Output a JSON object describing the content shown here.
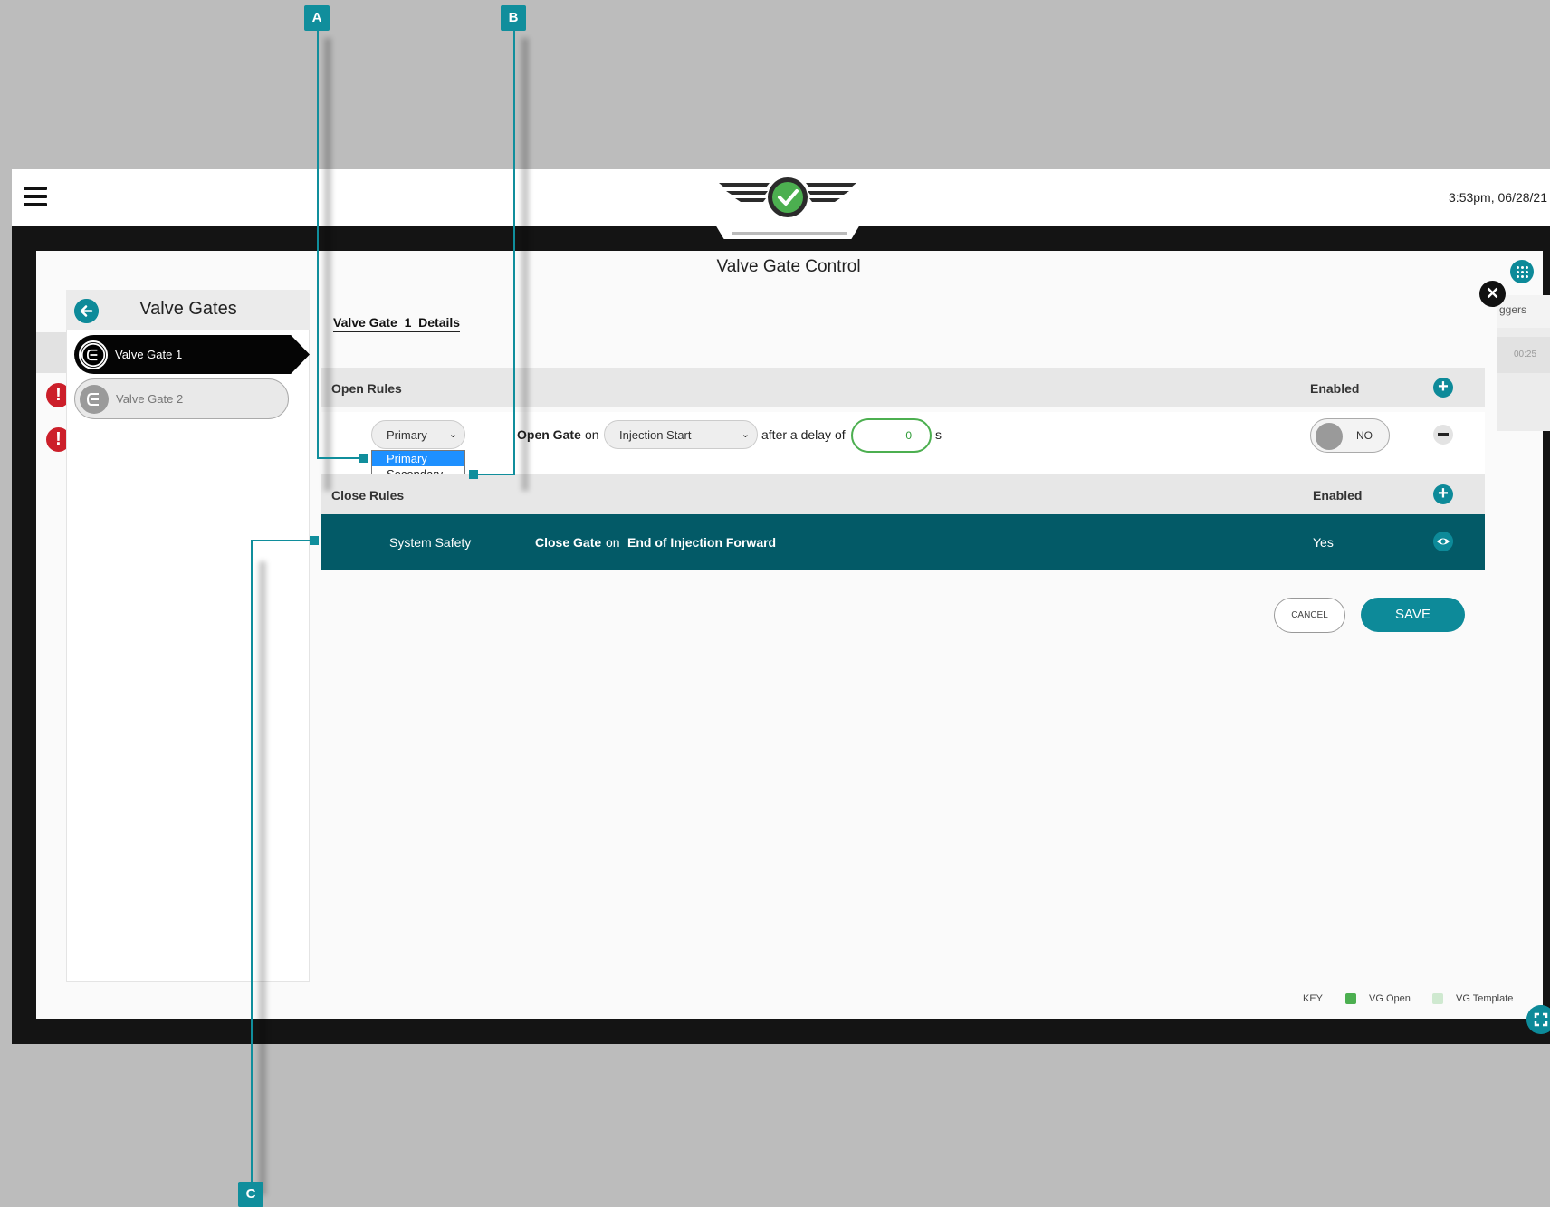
{
  "header": {
    "menu_icon": "hamburger-menu-icon",
    "logo_icon": "winged-checkmark-logo-icon",
    "timestamp": "3:53pm, 06/28/21"
  },
  "modal": {
    "title": "Valve Gate Control",
    "grid_icon": "apps-grid-icon",
    "close_icon": "close-icon",
    "expand_icon": "fullscreen-icon"
  },
  "background": {
    "right_tab_label": "ggers",
    "right_time": "00:25",
    "warning_icon": "alert-exclamation-icon",
    "warning_glyph": "!"
  },
  "sidebar": {
    "title": "Valve Gates",
    "back_icon": "back-arrow-icon",
    "items": [
      {
        "label": "Valve Gate 1",
        "active": true,
        "icon": "valve-gate-icon"
      },
      {
        "label": "Valve Gate 2",
        "active": false,
        "icon": "valve-gate-icon"
      }
    ]
  },
  "details": {
    "title": "Valve Gate  1  Details",
    "open_rules": {
      "label": "Open Rules",
      "enabled_label": "Enabled",
      "add_icon": "plus-icon",
      "rule": {
        "priority_value": "Primary",
        "priority_options": [
          "Primary",
          "Secondary"
        ],
        "action": "Open Gate",
        "on": "on",
        "trigger_value": "Injection Start",
        "after_delay": "after a delay of",
        "delay_value": "0",
        "unit": "s",
        "toggle_label": "NO",
        "remove_icon": "minus-icon"
      }
    },
    "close_rules": {
      "label": "Close Rules",
      "enabled_label": "Enabled",
      "add_icon": "plus-icon",
      "rule": {
        "source": "System Safety",
        "action": "Close Gate",
        "on": "on",
        "trigger": "End of Injection Forward",
        "enabled": "Yes",
        "view_icon": "eye-icon"
      }
    },
    "cancel_label": "CANCEL",
    "save_label": "SAVE"
  },
  "key": {
    "label": "KEY",
    "items": [
      {
        "label": "VG Open",
        "color": "#4caf50"
      },
      {
        "label": "VG Template",
        "color": "#cfe9d0"
      }
    ]
  },
  "callouts": [
    "A",
    "B",
    "C"
  ],
  "colors": {
    "accent": "#0d8a99",
    "row_highlight": "#035a67",
    "warning": "#cc1f2a",
    "dropdown_selected": "#1e90ff"
  }
}
